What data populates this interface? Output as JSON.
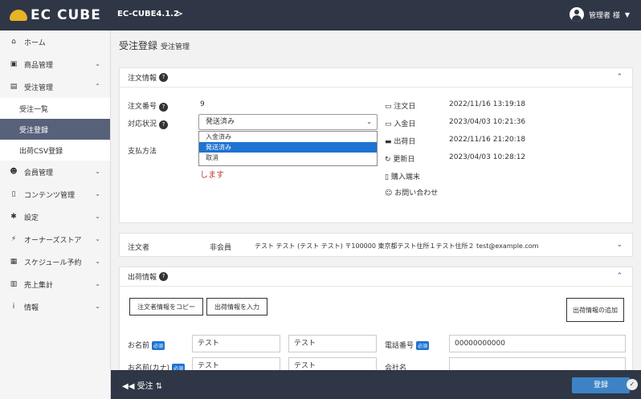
{
  "header": {
    "logo": "EC CUBE",
    "version": "EC-CUBE4.1.2",
    "version_chevron": ">",
    "user_name": "管理者 様",
    "user_chevron": "▼"
  },
  "sidebar": {
    "items": [
      {
        "icon": "⌂",
        "label": "ホーム"
      },
      {
        "icon": "▣",
        "label": "商品管理",
        "chevron": "⌄"
      },
      {
        "icon": "▤",
        "label": "受注管理",
        "chevron": "⌃"
      },
      {
        "icon": "☻",
        "label": "会員管理",
        "chevron": "⌄"
      },
      {
        "icon": "▯",
        "label": "コンテンツ管理",
        "chevron": "⌄"
      },
      {
        "icon": "✱",
        "label": "設定",
        "chevron": "⌄"
      },
      {
        "icon": "⚡",
        "label": "オーナーズストア",
        "chevron": "⌄"
      },
      {
        "icon": "▦",
        "label": "スケジュール予約",
        "chevron": "⌄"
      },
      {
        "icon": "▥",
        "label": "売上集計",
        "chevron": "⌄"
      },
      {
        "icon": "i",
        "label": "情報",
        "chevron": "⌄"
      }
    ],
    "sub_items": [
      "受注一覧",
      "受注登録",
      "出荷CSV登録"
    ]
  },
  "page": {
    "title": "受注登録",
    "subtitle": "受注管理"
  },
  "order_info": {
    "title": "注文情報",
    "toggle": "⌃",
    "order_no_label": "注文番号",
    "order_no_value": "9",
    "status_label": "対応状況",
    "status_value": "発送済み",
    "status_options": [
      "入金済み",
      "発送済み",
      "取消"
    ],
    "selected_option_index": 1,
    "payment_label": "支払方法",
    "warning": "します",
    "dates": [
      {
        "icon": "▭",
        "label": "注文日",
        "value": "2022/11/16 13:19:18"
      },
      {
        "icon": "▭",
        "label": "入金日",
        "value": "2023/04/03 10:21:36"
      },
      {
        "icon": "▬",
        "label": "出荷日",
        "value": "2022/11/16 21:20:18"
      },
      {
        "icon": "↻",
        "label": "更新日",
        "value": "2023/04/03 10:28:12"
      },
      {
        "icon": "▯",
        "label": "購入端末",
        "value": ""
      },
      {
        "icon": "☺",
        "label": "お問い合わせ",
        "value": ""
      }
    ]
  },
  "orderer": {
    "title": "注文者",
    "member_type": "非会員",
    "summary": "テスト テスト (テスト テスト) 〒100000 東京都テスト住所１テスト住所２ test@example.com",
    "toggle": "⌄"
  },
  "shipping": {
    "title": "出荷情報",
    "toggle": "⌃",
    "copy_button": "注文者情報をコピー",
    "ship_button": "出荷情報を入力",
    "add_button": "出荷情報の追加",
    "name_label": "お名前",
    "required": "必須",
    "name_last": "テスト",
    "name_first": "テスト",
    "phone_label": "電話番号",
    "phone_value": "00000000000",
    "kana_label": "お名前(カナ)",
    "kana_last": "テスト",
    "kana_first": "テスト",
    "company_label": "会社名"
  },
  "footer": {
    "back_label": "受注",
    "register_label": "登録"
  }
}
